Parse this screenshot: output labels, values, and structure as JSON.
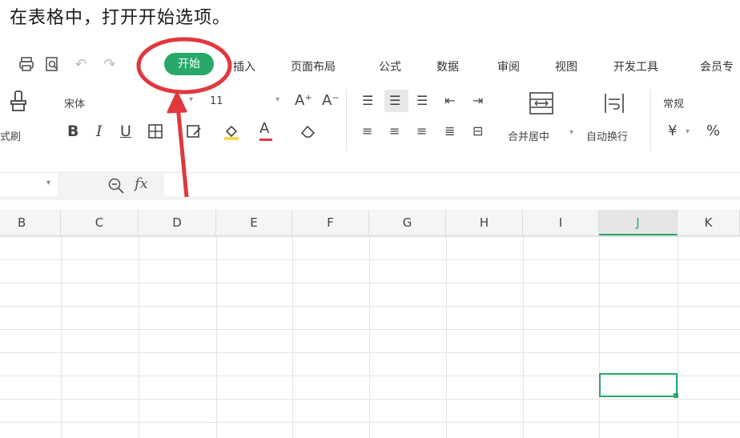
{
  "instruction": "在表格中，打开开始选项。",
  "menu": {
    "tabs": [
      "开始",
      "插入",
      "页面布局",
      "公式",
      "数据",
      "审阅",
      "视图",
      "开发工具",
      "会员专"
    ],
    "active_tab": "开始"
  },
  "ribbon": {
    "format_painter": "式刷",
    "font_name": "宋体",
    "font_size": "11",
    "merge_center": "合并居中",
    "wrap_text": "自动换行",
    "number_format": "常规",
    "currency": "¥",
    "percent": "%",
    "bold": "B",
    "italic": "I",
    "underline": "U",
    "grow_font": "A⁺",
    "shrink_font": "A⁻",
    "font_color_letter": "A"
  },
  "formula_bar": {
    "fx": "fx",
    "value": ""
  },
  "columns": [
    "B",
    "C",
    "D",
    "E",
    "F",
    "G",
    "H",
    "I",
    "J",
    "K"
  ],
  "selected_column": "J",
  "colors": {
    "accent": "#28a86b",
    "annotation": "#e0383e"
  }
}
